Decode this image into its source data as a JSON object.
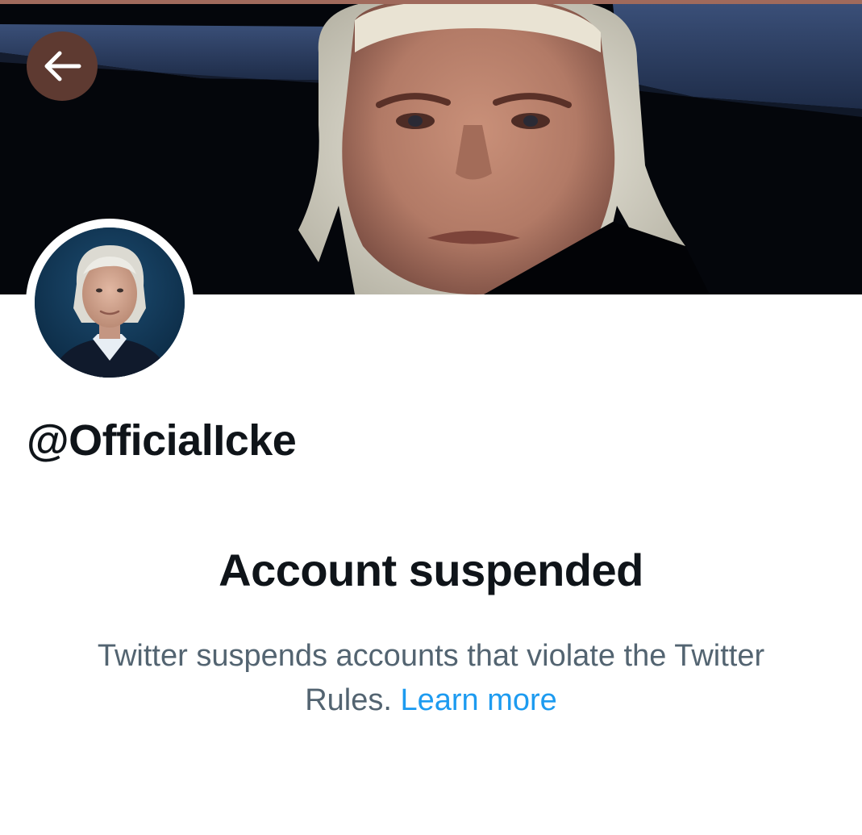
{
  "profile": {
    "handle": "@OfficialIcke"
  },
  "suspension": {
    "title": "Account suspended",
    "message": "Twitter suspends accounts that violate the Twitter Rules.",
    "link_label": "Learn more"
  },
  "icons": {
    "back": "arrow-left-icon"
  },
  "colors": {
    "title_text": "#0f1419",
    "secondary_text": "#536471",
    "link": "#1d9bf0",
    "back_button_bg": "#5e3a31"
  }
}
